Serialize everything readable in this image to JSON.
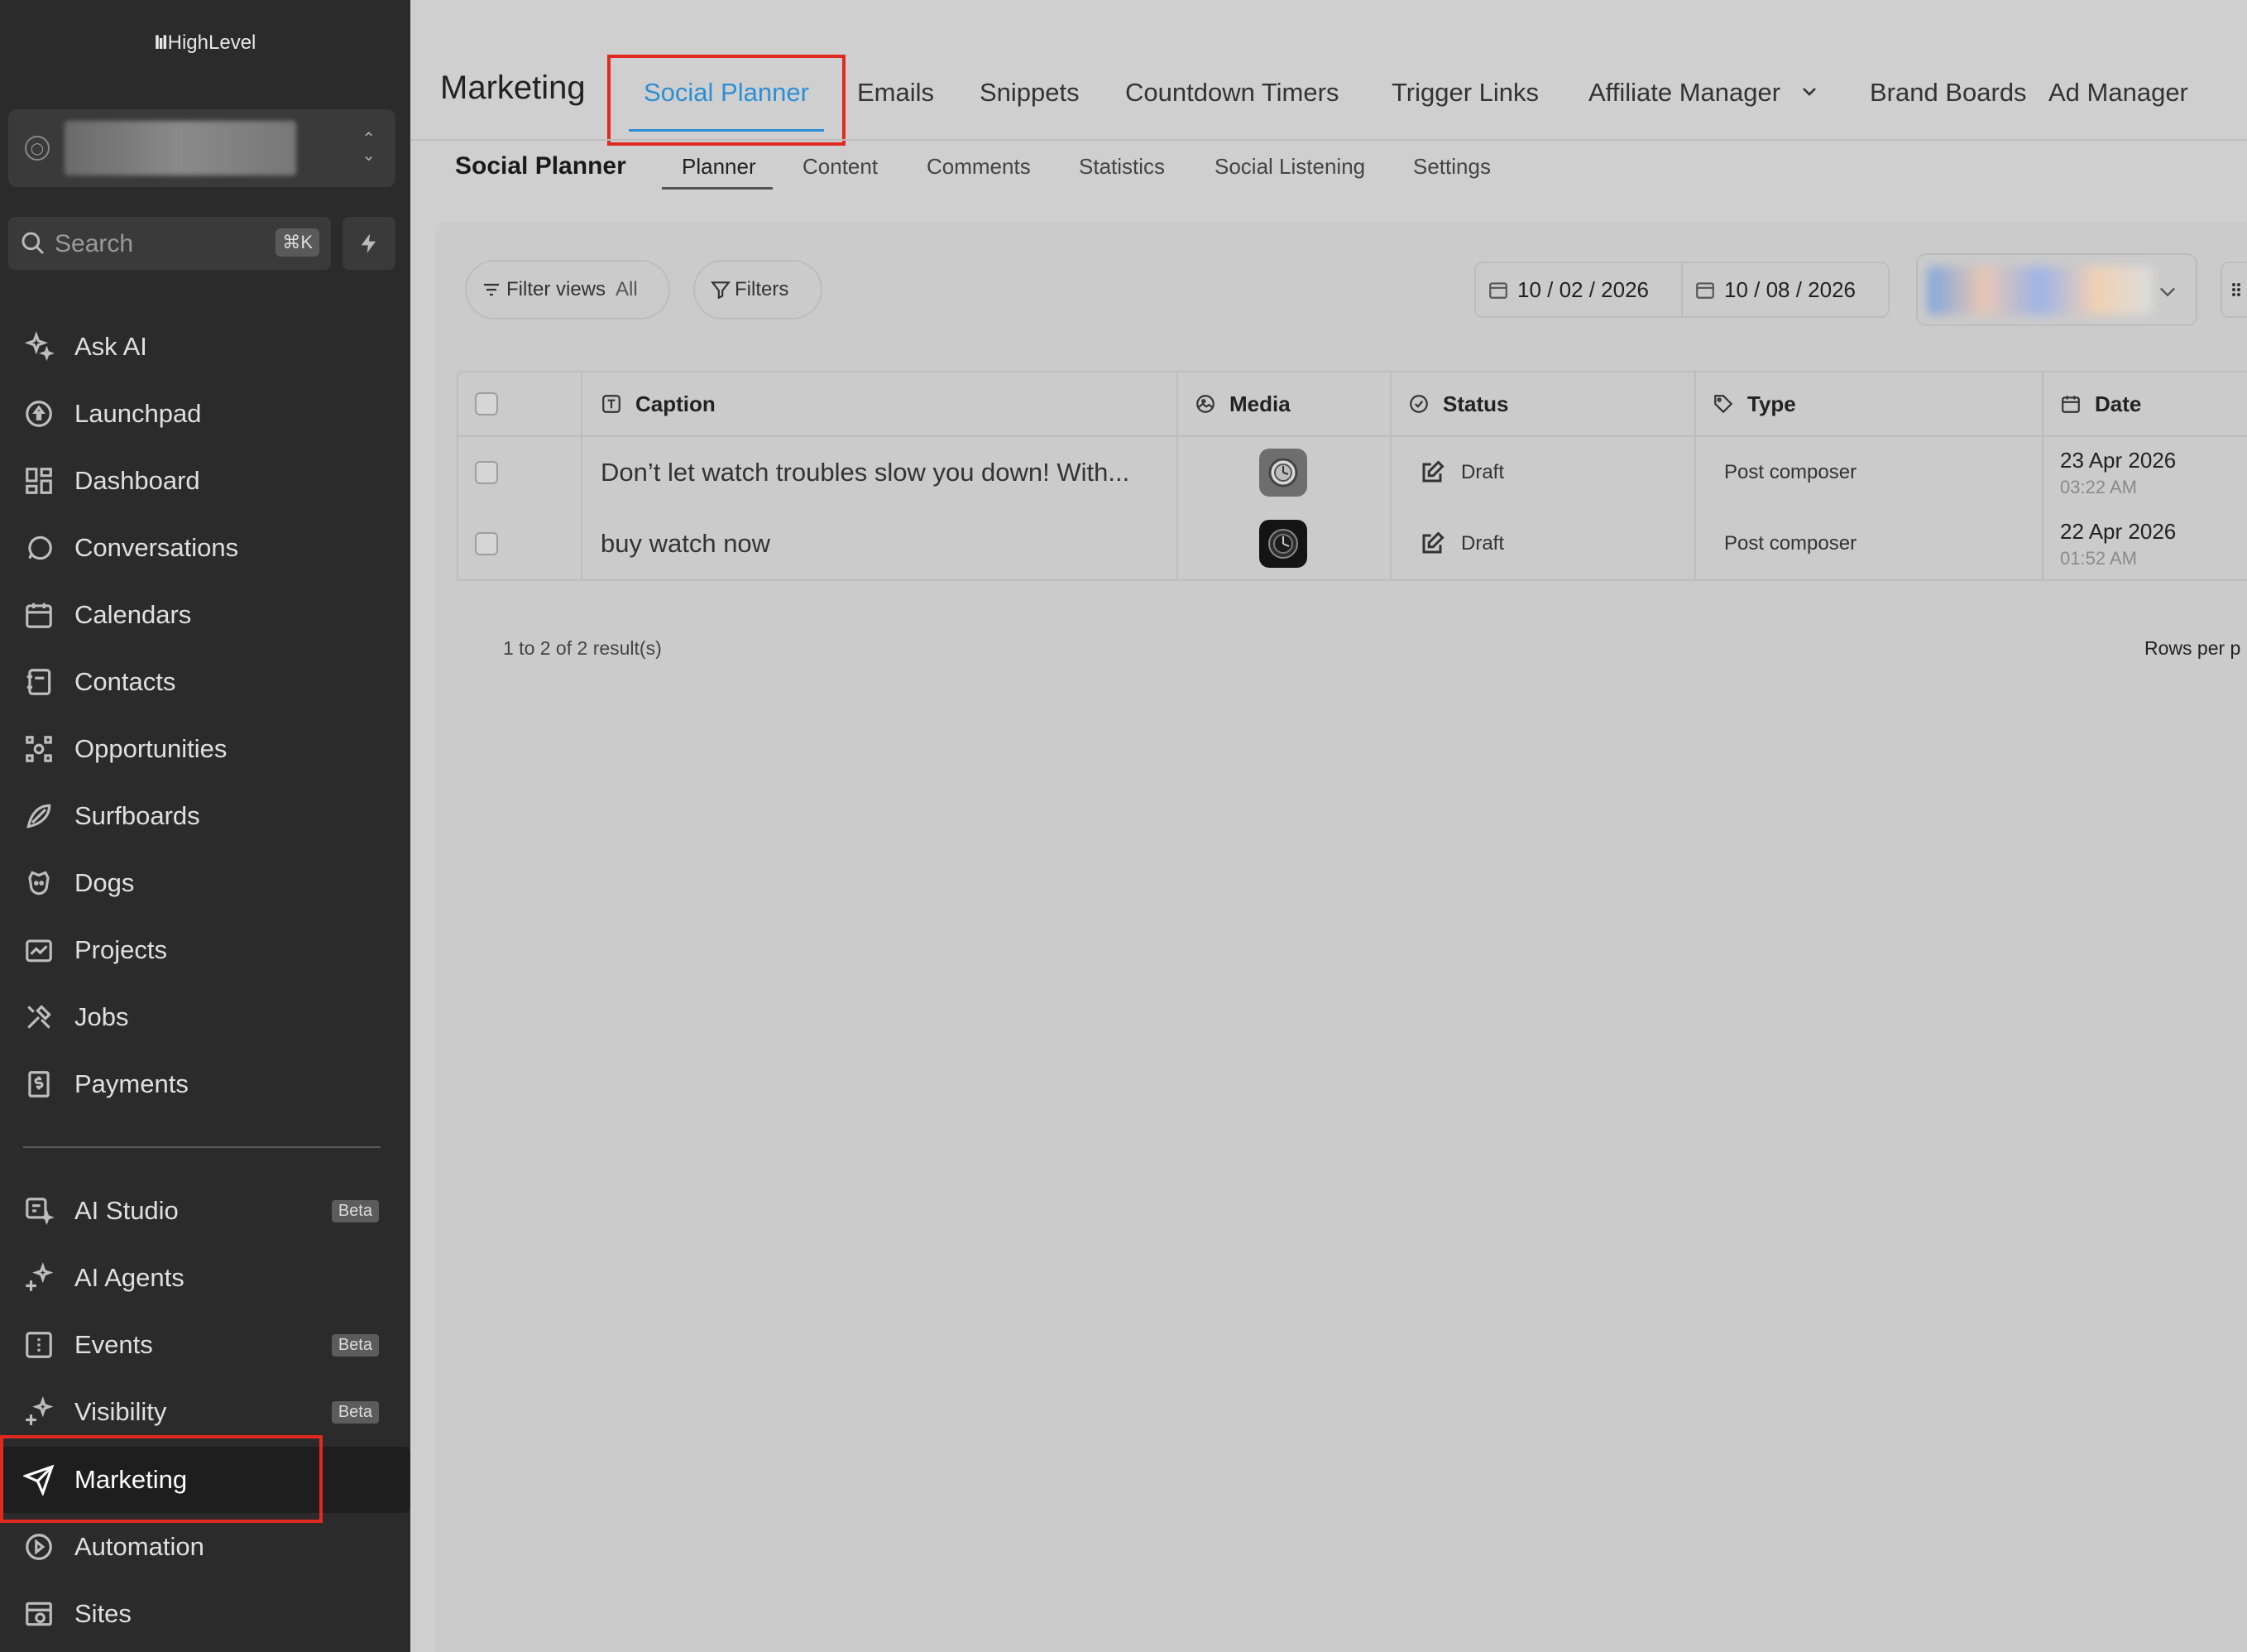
{
  "app": {
    "logo_mark": "IıI",
    "logo_text": "HighLevel"
  },
  "search": {
    "placeholder": "Search",
    "shortcut": "⌘K"
  },
  "sidebar": {
    "items": [
      {
        "label": "Ask AI",
        "icon": "sparkles-icon"
      },
      {
        "label": "Launchpad",
        "icon": "rocket-icon"
      },
      {
        "label": "Dashboard",
        "icon": "dashboard-icon"
      },
      {
        "label": "Conversations",
        "icon": "chat-icon"
      },
      {
        "label": "Calendars",
        "icon": "calendar-icon"
      },
      {
        "label": "Contacts",
        "icon": "contacts-icon"
      },
      {
        "label": "Opportunities",
        "icon": "opportunities-icon"
      },
      {
        "label": "Surfboards",
        "icon": "surfboard-icon"
      },
      {
        "label": "Dogs",
        "icon": "dog-icon"
      },
      {
        "label": "Projects",
        "icon": "projects-icon"
      },
      {
        "label": "Jobs",
        "icon": "tools-icon"
      },
      {
        "label": "Payments",
        "icon": "payments-icon"
      }
    ],
    "secondary": [
      {
        "label": "AI Studio",
        "badge": "Beta",
        "icon": "ai-studio-icon"
      },
      {
        "label": "AI Agents",
        "badge": "",
        "icon": "ai-agents-icon"
      },
      {
        "label": "Events",
        "badge": "Beta",
        "icon": "events-icon"
      },
      {
        "label": "Visibility",
        "badge": "Beta",
        "icon": "visibility-icon"
      },
      {
        "label": "Marketing",
        "badge": "",
        "icon": "send-icon"
      },
      {
        "label": "Automation",
        "badge": "",
        "icon": "automation-icon"
      },
      {
        "label": "Sites",
        "badge": "",
        "icon": "sites-icon"
      }
    ]
  },
  "header": {
    "title": "Marketing",
    "tabs": [
      "Social Planner",
      "Emails",
      "Snippets",
      "Countdown Timers",
      "Trigger Links",
      "Affiliate Manager",
      "Brand Boards",
      "Ad Manager"
    ],
    "active_tab": "Social Planner"
  },
  "subheader": {
    "title": "Social Planner",
    "tabs": [
      "Planner",
      "Content",
      "Comments",
      "Statistics",
      "Social Listening",
      "Settings"
    ],
    "active_tab": "Planner"
  },
  "filters": {
    "filter_views_label": "Filter views",
    "filter_views_value": "All",
    "filters_label": "Filters",
    "date_from": "10 / 02 / 2026",
    "date_to": "10 / 08 / 2026"
  },
  "table": {
    "columns": [
      "Caption",
      "Media",
      "Status",
      "Type",
      "Date"
    ],
    "rows": [
      {
        "caption": "Don’t let watch troubles slow you down! With...",
        "status": "Draft",
        "type": "Post composer",
        "date": "23 Apr 2026",
        "time": "03:22 AM"
      },
      {
        "caption": "buy watch now",
        "status": "Draft",
        "type": "Post composer",
        "date": "22 Apr 2026",
        "time": "01:52 AM"
      }
    ]
  },
  "pagination": {
    "results": "1 to 2 of 2 result(s)",
    "rows_per_page_label": "Rows per p"
  },
  "colors": {
    "accent": "#2b8fd6",
    "highlight": "#e0291f",
    "sidebar_bg": "#2b2b2b"
  }
}
